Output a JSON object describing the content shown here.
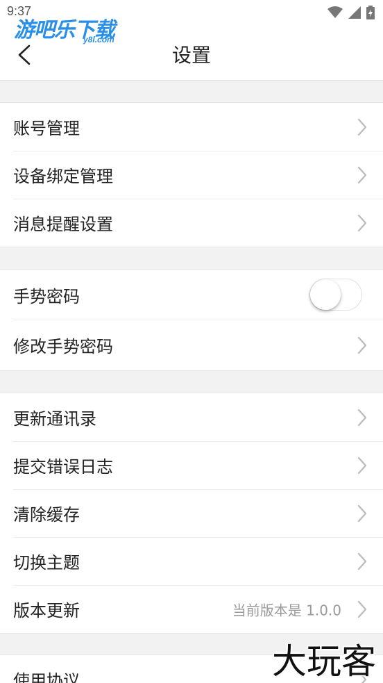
{
  "status": {
    "time": "9:37",
    "icons": [
      "wifi-icon",
      "signal-icon",
      "battery-charging-icon"
    ]
  },
  "watermark": {
    "logo_main": "游吧乐下载",
    "logo_sub": "y8l.com",
    "brand_corner": "大玩客"
  },
  "header": {
    "title": "设置",
    "back_icon": "chevron-left-icon"
  },
  "sections": [
    {
      "items": [
        {
          "label": "账号管理"
        },
        {
          "label": "设备绑定管理"
        },
        {
          "label": "消息提醒设置"
        }
      ]
    },
    {
      "items": [
        {
          "label": "手势密码",
          "toggle": false
        },
        {
          "label": "修改手势密码"
        }
      ]
    },
    {
      "items": [
        {
          "label": "更新通讯录"
        },
        {
          "label": "提交错误日志"
        },
        {
          "label": "清除缓存"
        },
        {
          "label": "切换主题"
        },
        {
          "label": "版本更新",
          "value": "当前版本是 1.0.0"
        }
      ]
    },
    {
      "items": [
        {
          "label": "使用协议"
        }
      ]
    }
  ],
  "colors": {
    "background": "#f2f2f2",
    "surface": "#ffffff",
    "text": "#222222",
    "secondary_text": "#9a9a9a",
    "chevron": "#bdbdbd",
    "watermark_blue": "#2a8fe8"
  }
}
